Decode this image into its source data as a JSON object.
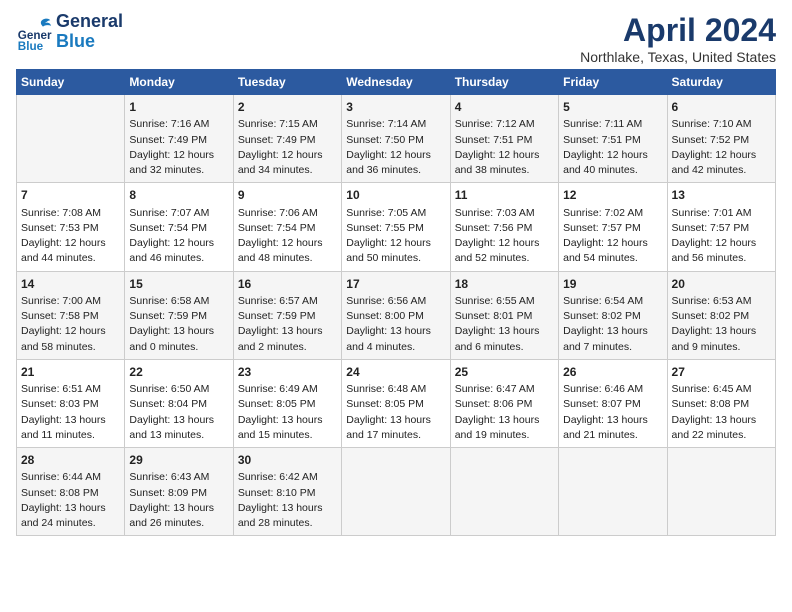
{
  "header": {
    "logo_general": "General",
    "logo_blue": "Blue",
    "title": "April 2024",
    "subtitle": "Northlake, Texas, United States"
  },
  "days_of_week": [
    "Sunday",
    "Monday",
    "Tuesday",
    "Wednesday",
    "Thursday",
    "Friday",
    "Saturday"
  ],
  "weeks": [
    [
      {
        "day": "",
        "content": ""
      },
      {
        "day": "1",
        "content": "Sunrise: 7:16 AM\nSunset: 7:49 PM\nDaylight: 12 hours\nand 32 minutes."
      },
      {
        "day": "2",
        "content": "Sunrise: 7:15 AM\nSunset: 7:49 PM\nDaylight: 12 hours\nand 34 minutes."
      },
      {
        "day": "3",
        "content": "Sunrise: 7:14 AM\nSunset: 7:50 PM\nDaylight: 12 hours\nand 36 minutes."
      },
      {
        "day": "4",
        "content": "Sunrise: 7:12 AM\nSunset: 7:51 PM\nDaylight: 12 hours\nand 38 minutes."
      },
      {
        "day": "5",
        "content": "Sunrise: 7:11 AM\nSunset: 7:51 PM\nDaylight: 12 hours\nand 40 minutes."
      },
      {
        "day": "6",
        "content": "Sunrise: 7:10 AM\nSunset: 7:52 PM\nDaylight: 12 hours\nand 42 minutes."
      }
    ],
    [
      {
        "day": "7",
        "content": "Sunrise: 7:08 AM\nSunset: 7:53 PM\nDaylight: 12 hours\nand 44 minutes."
      },
      {
        "day": "8",
        "content": "Sunrise: 7:07 AM\nSunset: 7:54 PM\nDaylight: 12 hours\nand 46 minutes."
      },
      {
        "day": "9",
        "content": "Sunrise: 7:06 AM\nSunset: 7:54 PM\nDaylight: 12 hours\nand 48 minutes."
      },
      {
        "day": "10",
        "content": "Sunrise: 7:05 AM\nSunset: 7:55 PM\nDaylight: 12 hours\nand 50 minutes."
      },
      {
        "day": "11",
        "content": "Sunrise: 7:03 AM\nSunset: 7:56 PM\nDaylight: 12 hours\nand 52 minutes."
      },
      {
        "day": "12",
        "content": "Sunrise: 7:02 AM\nSunset: 7:57 PM\nDaylight: 12 hours\nand 54 minutes."
      },
      {
        "day": "13",
        "content": "Sunrise: 7:01 AM\nSunset: 7:57 PM\nDaylight: 12 hours\nand 56 minutes."
      }
    ],
    [
      {
        "day": "14",
        "content": "Sunrise: 7:00 AM\nSunset: 7:58 PM\nDaylight: 12 hours\nand 58 minutes."
      },
      {
        "day": "15",
        "content": "Sunrise: 6:58 AM\nSunset: 7:59 PM\nDaylight: 13 hours\nand 0 minutes."
      },
      {
        "day": "16",
        "content": "Sunrise: 6:57 AM\nSunset: 7:59 PM\nDaylight: 13 hours\nand 2 minutes."
      },
      {
        "day": "17",
        "content": "Sunrise: 6:56 AM\nSunset: 8:00 PM\nDaylight: 13 hours\nand 4 minutes."
      },
      {
        "day": "18",
        "content": "Sunrise: 6:55 AM\nSunset: 8:01 PM\nDaylight: 13 hours\nand 6 minutes."
      },
      {
        "day": "19",
        "content": "Sunrise: 6:54 AM\nSunset: 8:02 PM\nDaylight: 13 hours\nand 7 minutes."
      },
      {
        "day": "20",
        "content": "Sunrise: 6:53 AM\nSunset: 8:02 PM\nDaylight: 13 hours\nand 9 minutes."
      }
    ],
    [
      {
        "day": "21",
        "content": "Sunrise: 6:51 AM\nSunset: 8:03 PM\nDaylight: 13 hours\nand 11 minutes."
      },
      {
        "day": "22",
        "content": "Sunrise: 6:50 AM\nSunset: 8:04 PM\nDaylight: 13 hours\nand 13 minutes."
      },
      {
        "day": "23",
        "content": "Sunrise: 6:49 AM\nSunset: 8:05 PM\nDaylight: 13 hours\nand 15 minutes."
      },
      {
        "day": "24",
        "content": "Sunrise: 6:48 AM\nSunset: 8:05 PM\nDaylight: 13 hours\nand 17 minutes."
      },
      {
        "day": "25",
        "content": "Sunrise: 6:47 AM\nSunset: 8:06 PM\nDaylight: 13 hours\nand 19 minutes."
      },
      {
        "day": "26",
        "content": "Sunrise: 6:46 AM\nSunset: 8:07 PM\nDaylight: 13 hours\nand 21 minutes."
      },
      {
        "day": "27",
        "content": "Sunrise: 6:45 AM\nSunset: 8:08 PM\nDaylight: 13 hours\nand 22 minutes."
      }
    ],
    [
      {
        "day": "28",
        "content": "Sunrise: 6:44 AM\nSunset: 8:08 PM\nDaylight: 13 hours\nand 24 minutes."
      },
      {
        "day": "29",
        "content": "Sunrise: 6:43 AM\nSunset: 8:09 PM\nDaylight: 13 hours\nand 26 minutes."
      },
      {
        "day": "30",
        "content": "Sunrise: 6:42 AM\nSunset: 8:10 PM\nDaylight: 13 hours\nand 28 minutes."
      },
      {
        "day": "",
        "content": ""
      },
      {
        "day": "",
        "content": ""
      },
      {
        "day": "",
        "content": ""
      },
      {
        "day": "",
        "content": ""
      }
    ]
  ]
}
